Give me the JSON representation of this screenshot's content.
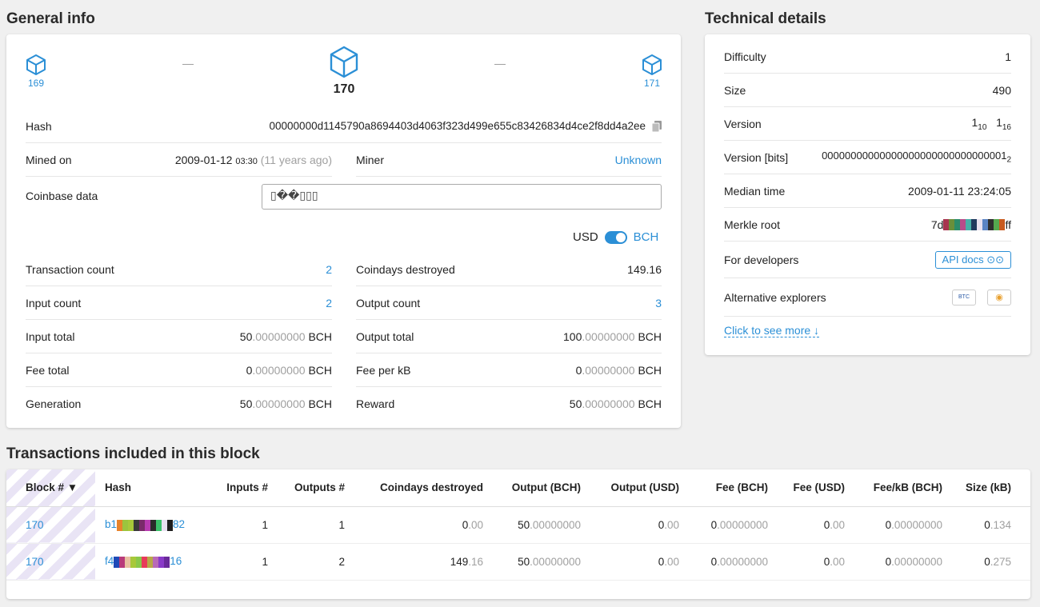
{
  "general": {
    "title": "General info",
    "prev_block": "169",
    "current_block": "170",
    "next_block": "171",
    "dash": "—",
    "hash_label": "Hash",
    "hash_value": "00000000d1145790a8694403d4063f323d499e655c83426834d4ce2f8dd4a2ee",
    "mined_label": "Mined on",
    "mined_date": "2009-01-12",
    "mined_time": "03:30",
    "mined_ago": "(11 years ago)",
    "miner_label": "Miner",
    "miner_value": "Unknown",
    "coinbase_label": "Coinbase data",
    "coinbase_value": "▯��▯▯▯",
    "toggle_left": "USD",
    "toggle_right": "BCH",
    "tx_count_label": "Transaction count",
    "tx_count": "2",
    "coindays_label": "Coindays destroyed",
    "coindays": "149.16",
    "input_count_label": "Input count",
    "input_count": "2",
    "output_count_label": "Output count",
    "output_count": "3",
    "input_total_label": "Input total",
    "input_total_int": "50",
    "input_total_dec": ".00000000",
    "output_total_label": "Output total",
    "output_total_int": "100",
    "output_total_dec": ".00000000",
    "fee_total_label": "Fee total",
    "fee_total_int": "0",
    "fee_total_dec": ".00000000",
    "fee_kb_label": "Fee per kB",
    "fee_kb_int": "0",
    "fee_kb_dec": ".00000000",
    "generation_label": "Generation",
    "generation_int": "50",
    "generation_dec": ".00000000",
    "reward_label": "Reward",
    "reward_int": "50",
    "reward_dec": ".00000000",
    "currency": "BCH"
  },
  "technical": {
    "title": "Technical details",
    "difficulty_label": "Difficulty",
    "difficulty": "1",
    "size_label": "Size",
    "size": "490",
    "version_label": "Version",
    "version_a": "1",
    "version_a_sub": "10",
    "version_b": "1",
    "version_b_sub": "16",
    "version_bits_label": "Version [bits]",
    "version_bits": "00000000000000000000000000000001",
    "version_bits_sub": "2",
    "median_label": "Median time",
    "median": "2009-01-11 23:24:05",
    "merkle_label": "Merkle root",
    "merkle_start": "7d",
    "merkle_end": "ff",
    "merkle_colors": [
      "#a8344e",
      "#6a8f3a",
      "#2c8c6a",
      "#b84b8a",
      "#46b0a8",
      "#1f3a5f",
      "#e8e2f0",
      "#5a84c4",
      "#2e2e2e",
      "#55a84e",
      "#c85a1e"
    ],
    "dev_label": "For developers",
    "api_label": "API docs",
    "alt_label": "Alternative explorers",
    "alt_btc": "BTC",
    "more_label": "Click to see more"
  },
  "transactions": {
    "title": "Transactions included in this block",
    "headers": [
      "Block #",
      "Hash",
      "Inputs #",
      "Outputs #",
      "Coindays destroyed",
      "Output (BCH)",
      "Output (USD)",
      "Fee (BCH)",
      "Fee (USD)",
      "Fee/kB (BCH)",
      "Size (kB)"
    ],
    "rows": [
      {
        "block": "170",
        "hash_start": "b1",
        "hash_end": "82",
        "inputs": "1",
        "outputs": "1",
        "cd_int": "0",
        "cd_dec": ".00",
        "out_bch_int": "50",
        "out_bch_dec": ".00000000",
        "out_usd_int": "0",
        "out_usd_dec": ".00",
        "fee_int": "0",
        "fee_dec": ".00000000",
        "fee_usd_int": "0",
        "fee_usd_dec": ".00",
        "feekb_int": "0",
        "feekb_dec": ".00000000",
        "size_int": "0",
        "size_dec": ".134",
        "colors": [
          "#e8832a",
          "#9bc43e",
          "#a8c83a",
          "#3a3a3a",
          "#7a2a6a",
          "#b83ab0",
          "#2a2a2a",
          "#3ac06a",
          "#e8e0f0",
          "#1e1e1e"
        ]
      },
      {
        "block": "170",
        "hash_start": "f4",
        "hash_end": "16",
        "inputs": "1",
        "outputs": "2",
        "cd_int": "149",
        "cd_dec": ".16",
        "out_bch_int": "50",
        "out_bch_dec": ".00000000",
        "out_usd_int": "0",
        "out_usd_dec": ".00",
        "fee_int": "0",
        "fee_dec": ".00000000",
        "fee_usd_int": "0",
        "fee_usd_dec": ".00",
        "feekb_int": "0",
        "feekb_dec": ".00000000",
        "size_int": "0",
        "size_dec": ".275",
        "colors": [
          "#1e4ab8",
          "#b83a7a",
          "#e8c0a0",
          "#a8c83a",
          "#8ac84a",
          "#e83a5a",
          "#b8a848",
          "#b86ab8",
          "#8a3ac8",
          "#6a2a9a"
        ]
      }
    ]
  }
}
